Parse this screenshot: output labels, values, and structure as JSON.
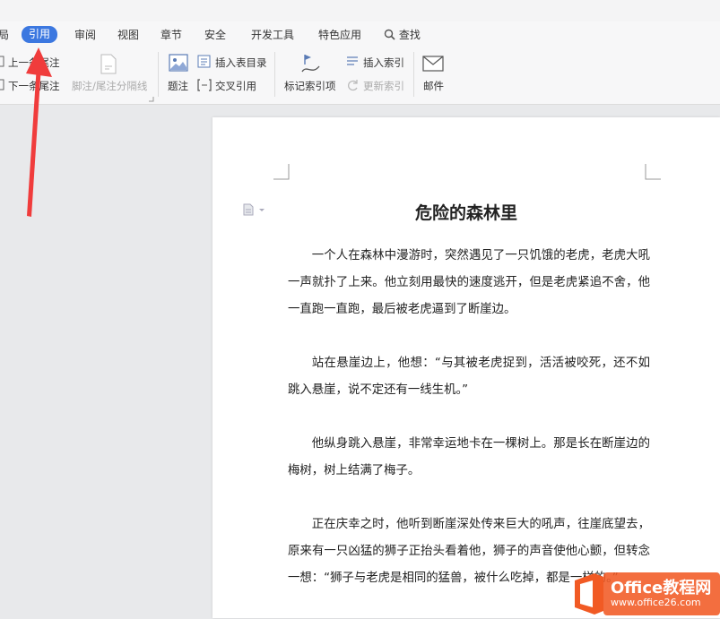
{
  "tabs": [
    {
      "label": "局"
    },
    {
      "label": "引用"
    },
    {
      "label": "审阅"
    },
    {
      "label": "视图"
    },
    {
      "label": "章节"
    },
    {
      "label": "安全"
    },
    {
      "label": "开发工具"
    },
    {
      "label": "特色应用"
    },
    {
      "label": "查找"
    }
  ],
  "ribbon": {
    "prev_footnote": "上一条尾注",
    "next_footnote": "下一条尾注",
    "separator_line": "脚注/尾注分隔线",
    "caption": "题注",
    "insert_table_of_figures": "插入表目录",
    "cross_reference": "交叉引用",
    "mark_index_entry": "标记索引项",
    "insert_index": "插入索引",
    "update_index": "更新索引",
    "mail": "邮件"
  },
  "document": {
    "title": "危险的森林里",
    "paragraphs": [
      "一个人在森林中漫游时，突然遇见了一只饥饿的老虎，老虎大吼一声就扑了上来。他立刻用最快的速度逃开，但是老虎紧追不舍，他一直跑一直跑，最后被老虎逼到了断崖边。",
      "站在悬崖边上，他想：“与其被老虎捉到，活活被咬死，还不如跳入悬崖，说不定还有一线生机。”",
      "他纵身跳入悬崖，非常幸运地卡在一棵树上。那是长在断崖边的梅树，树上结满了梅子。",
      "正在庆幸之时，他听到断崖深处传来巨大的吼声，往崖底望去，原来有一只凶猛的狮子正抬头看着他，狮子的声音使他心颤，但转念一想：“狮子与老虎是相同的猛兽，被什么吃掉，都是一样的。”"
    ]
  },
  "watermark": {
    "line1": "Office教程网",
    "line2": "www.office26.com"
  },
  "colors": {
    "accent": "#3c78e0",
    "arrow": "#f03c3c",
    "watermark_orange": "#f15a24"
  }
}
